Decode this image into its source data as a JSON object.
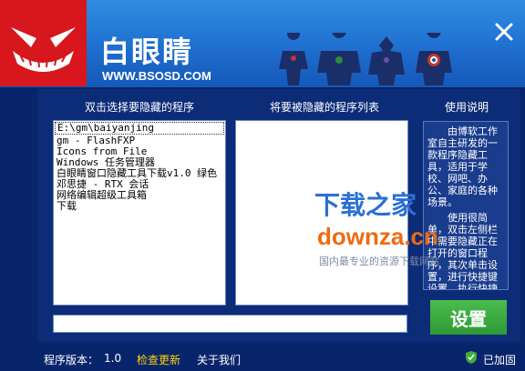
{
  "header": {
    "title": "白眼睛",
    "site": "WWW.BSOSD.COM"
  },
  "panels": {
    "source_title": "双击选择要隐藏的程序",
    "target_title": "将要被隐藏的程序列表",
    "help_title": "使用说明"
  },
  "source_list": [
    "E:\\gm\\baiyanjing",
    "gm - FlashFXP",
    "Icons from File",
    "Windows 任务管理器",
    "白眼睛窗口隐藏工具下载v1.0 绿色",
    "邓思捷 - RTX 会话",
    "网络编辑超级工具箱",
    "下载"
  ],
  "target_list": [],
  "help": {
    "p1": "由博软工作室自主研发的一款程序隐藏工具，适用于学校、网吧、办公、家庭的各种场景。",
    "p2": "使用很简单，双击左侧栏中需要隐藏正在打开的窗口程序，其次单击设置，进行快捷键设置。执行快捷键程序，即可被隐藏目标程序。"
  },
  "bottom_input": {
    "value": ""
  },
  "buttons": {
    "set": "设置"
  },
  "status": {
    "version_label": "程序版本：",
    "version": "1.0",
    "check_update": "检查更新",
    "about": "关于我们",
    "secure": "已加固"
  },
  "watermark": {
    "brand": "下载之家",
    "domain": "downza.cn",
    "slogan": "国内最专业的资源下载网站"
  },
  "colors": {
    "header": "#1f6fd0",
    "logo": "#d7161d",
    "body": "#0c2c78",
    "button": "#3aab3f",
    "link": "#ffd400"
  }
}
